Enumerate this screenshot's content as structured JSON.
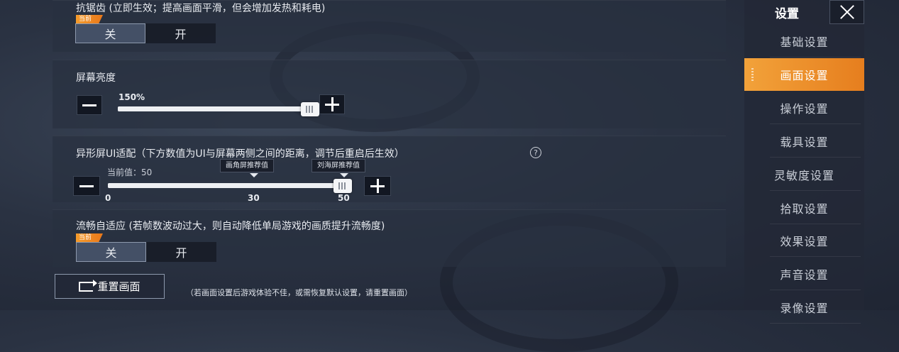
{
  "antialias": {
    "title": "抗锯齿 (立即生效；提高画面平滑，但会增加发热和耗电)",
    "current_tag": "当前",
    "options": [
      "关",
      "开"
    ],
    "selected": "关"
  },
  "brightness": {
    "title": "屏幕亮度",
    "value_label": "150%",
    "level_fraction": 1.0
  },
  "ui_adapt": {
    "title": "异形屏UI适配（下方数值为UI与屏幕两侧之间的距离，调节后重启后生效）",
    "help_glyph": "?",
    "current_value_label": "当前值：50",
    "current_value": 50,
    "range": [
      0,
      50
    ],
    "tick_labels": [
      "0",
      "30",
      "50"
    ],
    "recommend_round": "画角屏推荐值",
    "recommend_notch": "刘海屏推荐值"
  },
  "smooth_adapt": {
    "title": "流畅自适应 (若帧数波动过大，则自动降低单局游戏的画质提升流畅度)",
    "current_tag": "当前",
    "options": [
      "关",
      "开"
    ],
    "selected": "关"
  },
  "reset": {
    "label": "重置画面",
    "hint": "（若画面设置后游戏体验不佳，或需恢复默认设置，请重置画面）"
  },
  "sidebar": {
    "header": "设置",
    "items": [
      "基础设置",
      "画面设置",
      "操作设置",
      "载具设置",
      "灵敏度设置",
      "拾取设置",
      "效果设置",
      "声音设置",
      "录像设置"
    ],
    "active_index": 1
  },
  "colors": {
    "accent": "#f29a30",
    "panel": "#283040"
  }
}
